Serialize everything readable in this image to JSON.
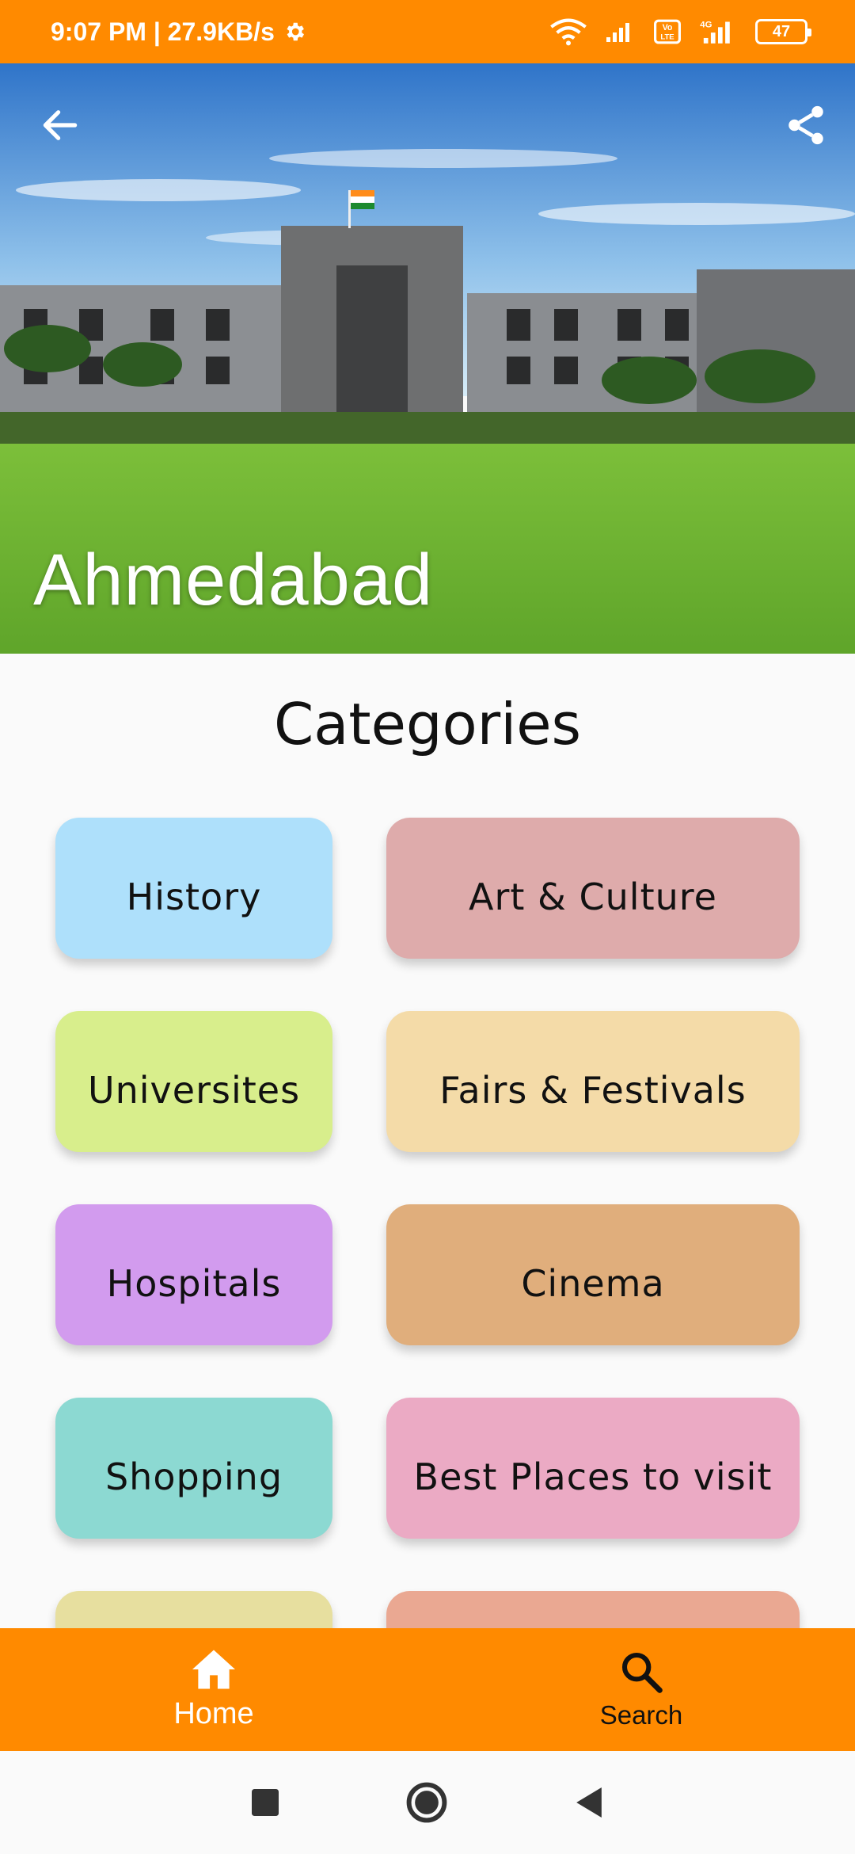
{
  "status_bar": {
    "time_speed": "9:07 PM | 27.9KB/s",
    "battery": "47",
    "icons": [
      "settings-gear-icon",
      "wifi-icon",
      "signal-icon",
      "volte-icon",
      "4g-signal-icon",
      "battery-icon"
    ]
  },
  "hero": {
    "title": "Ahmedabad",
    "back_icon": "arrow-left-icon",
    "share_icon": "share-icon"
  },
  "categories": {
    "heading": "Categories",
    "items": [
      {
        "label": "History",
        "color": "#aee0fb"
      },
      {
        "label": "Art & Culture",
        "color": "#deabab"
      },
      {
        "label": "Universites",
        "color": "#d8ee8c"
      },
      {
        "label": "Fairs & Festivals",
        "color": "#f4dba8"
      },
      {
        "label": "Hospitals",
        "color": "#d29bee"
      },
      {
        "label": "Cinema",
        "color": "#e0ae7c"
      },
      {
        "label": "Shopping",
        "color": "#8cd9d2"
      },
      {
        "label": "Best Places to visit",
        "color": "#ebaac4"
      },
      {
        "label": "",
        "color": "#e7df9f"
      },
      {
        "label": "",
        "color": "#eaa892"
      }
    ]
  },
  "bottom_nav": {
    "home_label": "Home",
    "search_label": "Search",
    "accent": "#ff8a00"
  },
  "system_nav": {
    "icons": [
      "recents-square-icon",
      "home-circle-icon",
      "back-triangle-icon"
    ]
  }
}
